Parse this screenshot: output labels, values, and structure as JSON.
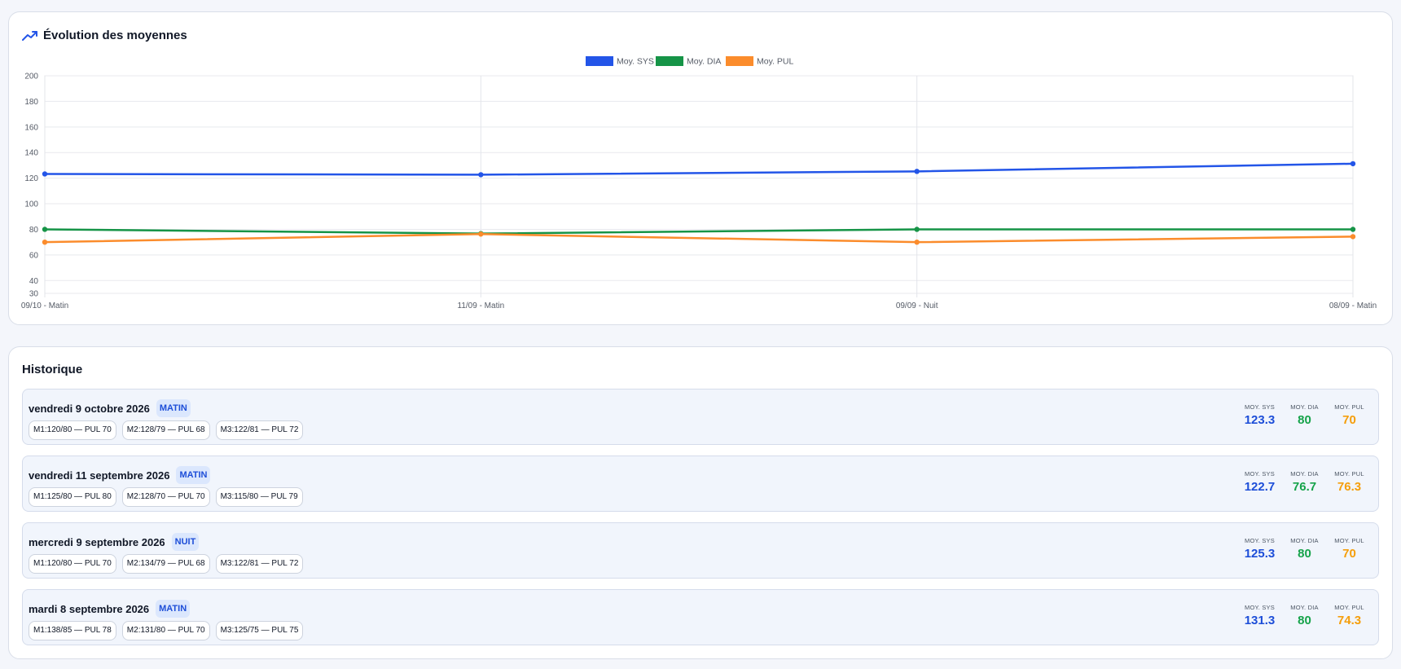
{
  "chart_card": {
    "title": "Évolution des moyennes",
    "icon": "trending-up-icon"
  },
  "chart_data": {
    "type": "line",
    "title": "",
    "categories": [
      "09/10 - Matin",
      "11/09 - Matin",
      "09/09 - Nuit",
      "08/09 - Matin"
    ],
    "series": [
      {
        "name": "Moy. SYS",
        "color": "#2355e8",
        "values": [
          123.3,
          122.7,
          125.3,
          131.3
        ]
      },
      {
        "name": "Moy. DIA",
        "color": "#169447",
        "values": [
          80,
          76.7,
          80,
          80
        ]
      },
      {
        "name": "Moy. PUL",
        "color": "#fb8c2c",
        "values": [
          70,
          76.3,
          70,
          74.3
        ]
      }
    ],
    "yticks": [
      200,
      180,
      160,
      140,
      120,
      100,
      80,
      60,
      40,
      30
    ],
    "ylim": [
      30,
      200
    ],
    "grid": true,
    "legend": "top-center"
  },
  "history": {
    "title": "Historique",
    "labels": {
      "sys": "MOY. SYS",
      "dia": "MOY. DIA",
      "pul": "MOY. PUL"
    },
    "entries": [
      {
        "date": "vendredi 9 octobre 2026",
        "period": "MATIN",
        "measures": [
          "M1:120/80 — PUL 70",
          "M2:128/79 — PUL 68",
          "M3:122/81 — PUL 72"
        ],
        "sys": "123.3",
        "dia": "80",
        "pul": "70"
      },
      {
        "date": "vendredi 11 septembre 2026",
        "period": "MATIN",
        "measures": [
          "M1:125/80 — PUL 80",
          "M2:128/70 — PUL 70",
          "M3:115/80 — PUL 79"
        ],
        "sys": "122.7",
        "dia": "76.7",
        "pul": "76.3"
      },
      {
        "date": "mercredi 9 septembre 2026",
        "period": "NUIT",
        "measures": [
          "M1:120/80 — PUL 70",
          "M2:134/79 — PUL 68",
          "M3:122/81 — PUL 72"
        ],
        "sys": "125.3",
        "dia": "80",
        "pul": "70"
      },
      {
        "date": "mardi 8 septembre 2026",
        "period": "MATIN",
        "measures": [
          "M1:138/85 — PUL 78",
          "M2:131/80 — PUL 70",
          "M3:125/75 — PUL 75"
        ],
        "sys": "131.3",
        "dia": "80",
        "pul": "74.3"
      }
    ]
  }
}
